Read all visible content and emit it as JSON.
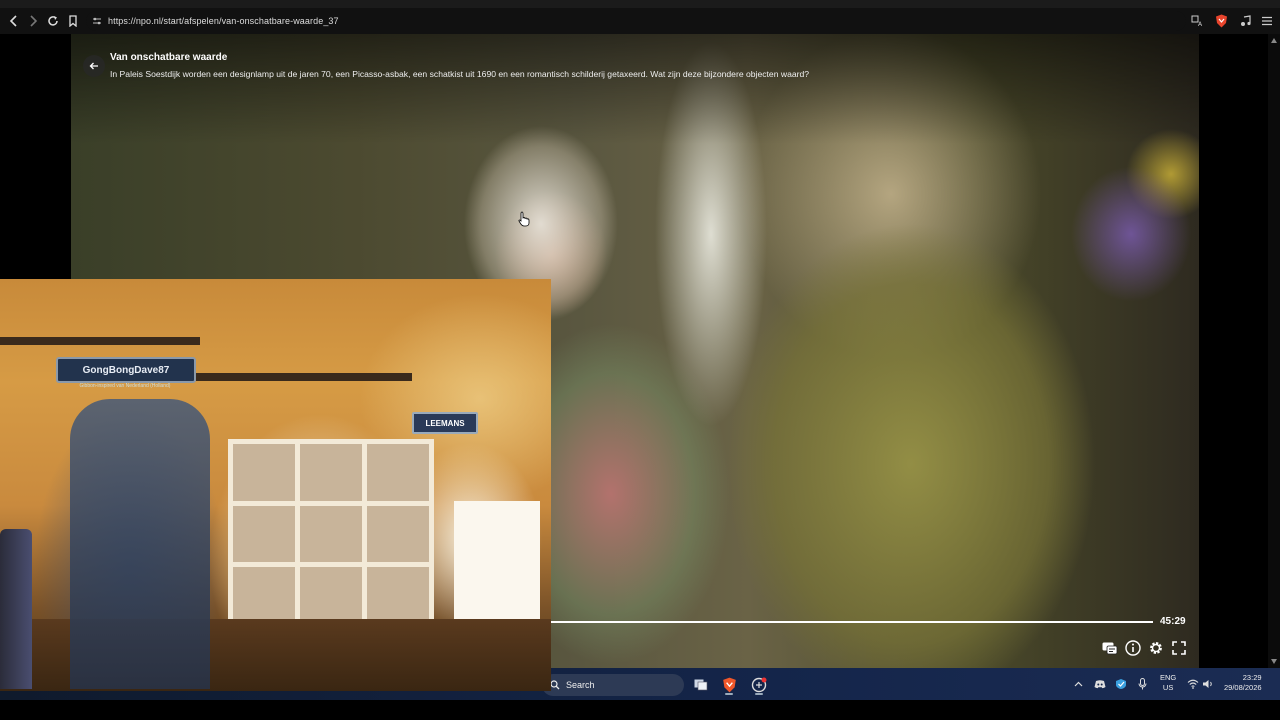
{
  "browser": {
    "url": "https://npo.nl/start/afspelen/van-onschatbare-waarde_37",
    "nav_icons": [
      "back-icon",
      "forward-icon",
      "reload-icon",
      "bookmark-icon"
    ],
    "right_icons": [
      "translate-icon",
      "brave-shield-icon",
      "media-icon",
      "menu-icon"
    ]
  },
  "player": {
    "title": "Van onschatbare waarde",
    "description": "In Paleis Soestdijk worden een designlamp uit de jaren 70, een Picasso-asbak, een schatkist uit 1690 en een romantisch schilderij getaxeerd. Wat zijn deze bijzondere objecten waard?",
    "duration": "45:29",
    "controls": [
      "subtitles-icon",
      "info-icon",
      "settings-icon",
      "fullscreen-icon"
    ]
  },
  "webcam": {
    "sign_text": "GongBongDave87",
    "sign_subtext": "Gibbon-inspired van Nederland (Holland)",
    "sign2_text": "LEEMANS"
  },
  "taskbar": {
    "search_label": "Search",
    "lang_top": "ENG",
    "lang_bottom": "US",
    "time": "23:29",
    "date": "29/08/2026"
  }
}
